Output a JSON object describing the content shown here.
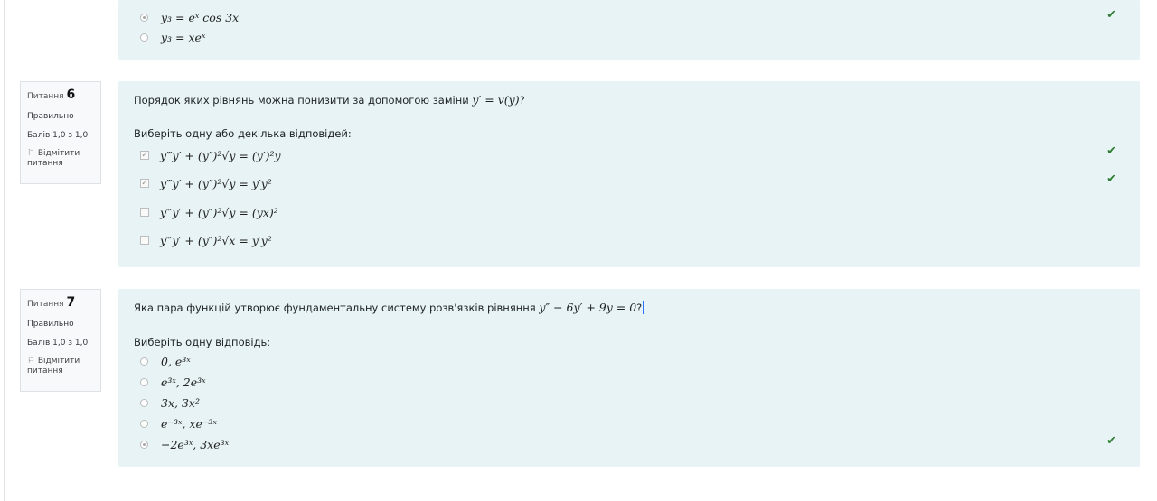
{
  "q5": {
    "options": [
      {
        "label": "y₃ = eˣ cos 3x",
        "selected": true,
        "correct": true
      },
      {
        "label": "y₃ = xeˣ",
        "selected": false,
        "correct": false
      }
    ],
    "tick": "✔"
  },
  "q6": {
    "info": {
      "prefix": "Питання",
      "number": "6",
      "status": "Правильно",
      "points": "Балів 1,0 з 1,0",
      "flag": "Відмітити питання",
      "flag_icon": "flag-icon"
    },
    "text": "Порядок яких рівнянь можна понизити за допомогою заміни",
    "text_math": "y′ = v(y)",
    "text_end": "?",
    "prompt": "Виберіть одну або декілька відповідей:",
    "options": [
      {
        "label": "y‴y′ + (y″)²√y = (y′)²y",
        "checked": true,
        "correct": true
      },
      {
        "label": "y‴y′ + (y″)²√y = y′y²",
        "checked": true,
        "correct": true
      },
      {
        "label": "y‴y′ + (y″)²√y = (yx)²",
        "checked": false,
        "correct": false
      },
      {
        "label": "y‴y′ + (y″)²√x = y′y²",
        "checked": false,
        "correct": false
      }
    ],
    "tick": "✔"
  },
  "q7": {
    "info": {
      "prefix": "Питання",
      "number": "7",
      "status": "Правильно",
      "points": "Балів 1,0 з 1,0",
      "flag": "Відмітити питання",
      "flag_icon": "flag-icon"
    },
    "text": "Яка пара функцій утворює фундаментальну систему розв'язків рівняння",
    "text_math": "y″ − 6y′ + 9y = 0",
    "text_end": "?",
    "prompt": "Виберіть одну відповідь:",
    "options": [
      {
        "label": "0, e³ˣ",
        "selected": false,
        "correct": false
      },
      {
        "label": "e³ˣ, 2e³ˣ",
        "selected": false,
        "correct": false
      },
      {
        "label": "3x, 3x²",
        "selected": false,
        "correct": false
      },
      {
        "label": "e⁻³ˣ, xe⁻³ˣ",
        "selected": false,
        "correct": false
      },
      {
        "label": "−2e³ˣ, 3xe³ˣ",
        "selected": true,
        "correct": true
      }
    ],
    "tick": "✔"
  },
  "colors": {
    "panel": "#e7f3f5",
    "correct": "#2e7d32",
    "info_bg": "#f8f9fa"
  }
}
